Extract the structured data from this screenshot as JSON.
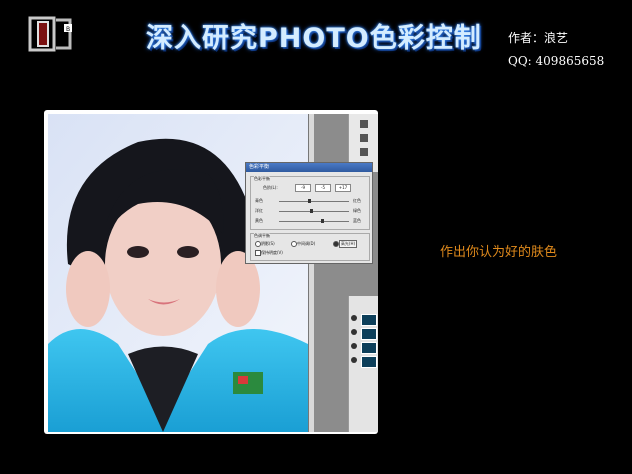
{
  "header": {
    "title": "深入研究PHOTO色彩控制",
    "author": "作者：浪艺",
    "qq": "QQ: 409865658"
  },
  "hint": "作出你认为好的肤色",
  "dialog": {
    "title": "色彩平衡",
    "balance_group": "色彩平衡",
    "levels_label": "色阶(L):",
    "levels": [
      "-9",
      "-5",
      "+17"
    ],
    "sliders": [
      {
        "left": "青色",
        "right": "红色",
        "pos": 0.44
      },
      {
        "left": "洋红",
        "right": "绿色",
        "pos": 0.46
      },
      {
        "left": "黄色",
        "right": "蓝色",
        "pos": 0.62
      }
    ],
    "tone_group": "色调平衡",
    "tones": [
      "阴影(S)",
      "中间调(D)",
      "高光(H)"
    ],
    "preserve_luminosity": "保持明度(V)"
  }
}
